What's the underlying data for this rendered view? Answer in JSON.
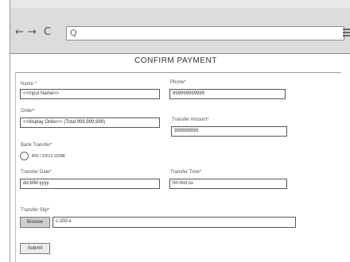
{
  "browser": {
    "nav_back": "←",
    "nav_forward": "→",
    "nav_reload": "C",
    "search_glyph": "Q"
  },
  "page": {
    "title": "CONFIRM PAYMENT"
  },
  "form": {
    "name_label": "Name *",
    "name_value": "<<Input Name>>",
    "phone_label": "Phone*",
    "phone_value": "999999999999",
    "order_label": "Order*",
    "order_value": "<<display Order>> (Total 999,999,999)",
    "transfer_amount_label": "Transfer Amount*",
    "transfer_amount_value": "999999999",
    "bank_transfer_label": "Bank Transfer*",
    "bank_option": "BRI / 10512 15288",
    "transfer_date_label": "Transfer Date*",
    "transfer_date_value": "dd-MM-yyyy",
    "transfer_time_label": "Transfer Time*",
    "transfer_time_value": "hh:mm:ss",
    "transfer_slip_label": "Transfer Slip*",
    "browse_label": "Browse",
    "file_value": "c:200-x",
    "submit_label": "Submit"
  }
}
